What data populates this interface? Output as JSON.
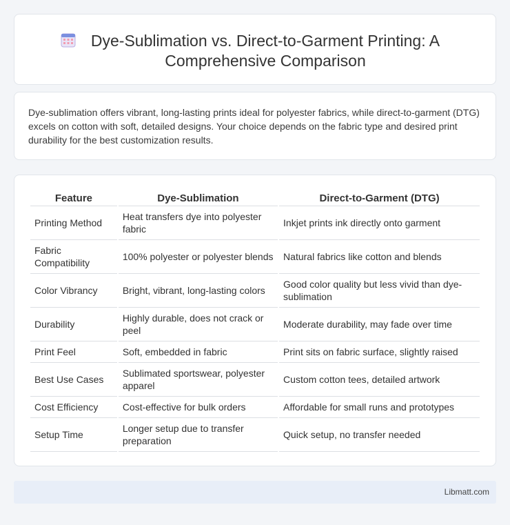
{
  "header": {
    "title": "Dye-Sublimation vs. Direct-to-Garment Printing: A Comprehensive Comparison",
    "icon": "calendar-grid-icon"
  },
  "intro": {
    "text": "Dye-sublimation offers vibrant, long-lasting prints ideal for polyester fabrics, while direct-to-garment (DTG) excels on cotton with soft, detailed designs. Your choice depends on the fabric type and desired print durability for the best customization results."
  },
  "table": {
    "headers": [
      "Feature",
      "Dye-Sublimation",
      "Direct-to-Garment (DTG)"
    ],
    "rows": [
      [
        "Printing Method",
        "Heat transfers dye into polyester fabric",
        "Inkjet prints ink directly onto garment"
      ],
      [
        "Fabric Compatibility",
        "100% polyester or polyester blends",
        "Natural fabrics like cotton and blends"
      ],
      [
        "Color Vibrancy",
        "Bright, vibrant, long-lasting colors",
        "Good color quality but less vivid than dye-sublimation"
      ],
      [
        "Durability",
        "Highly durable, does not crack or peel",
        "Moderate durability, may fade over time"
      ],
      [
        "Print Feel",
        "Soft, embedded in fabric",
        "Print sits on fabric surface, slightly raised"
      ],
      [
        "Best Use Cases",
        "Sublimated sportswear, polyester apparel",
        "Custom cotton tees, detailed artwork"
      ],
      [
        "Cost Efficiency",
        "Cost-effective for bulk orders",
        "Affordable for small runs and prototypes"
      ],
      [
        "Setup Time",
        "Longer setup due to transfer preparation",
        "Quick setup, no transfer needed"
      ]
    ]
  },
  "footer": {
    "brand": "Libmatt.com"
  }
}
